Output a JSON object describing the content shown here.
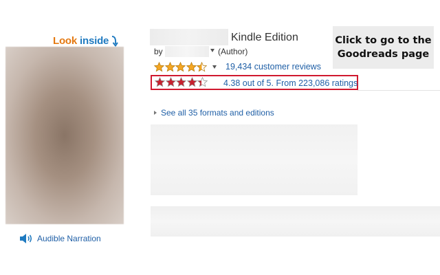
{
  "look_inside": {
    "look": "Look",
    "inside": "inside"
  },
  "audible": {
    "label": "Audible Narration"
  },
  "product": {
    "edition": "Kindle Edition",
    "by_label": "by",
    "author_role": "(Author)"
  },
  "amazon_rating": {
    "stars": 4.5,
    "reviews_label": "19,434 customer reviews"
  },
  "goodreads_rating": {
    "stars": 4.38,
    "text": "4.38 out of 5. From 223,086 ratings"
  },
  "tooltip": {
    "line1": "Click to go to the",
    "line2": "Goodreads page"
  },
  "formats": {
    "label": "See all 35 formats and editions"
  },
  "colors": {
    "amazon_star": "#f5a623",
    "goodreads_star": "#c7202e",
    "link": "#1f5fa6",
    "highlight_border": "#d0182e"
  }
}
